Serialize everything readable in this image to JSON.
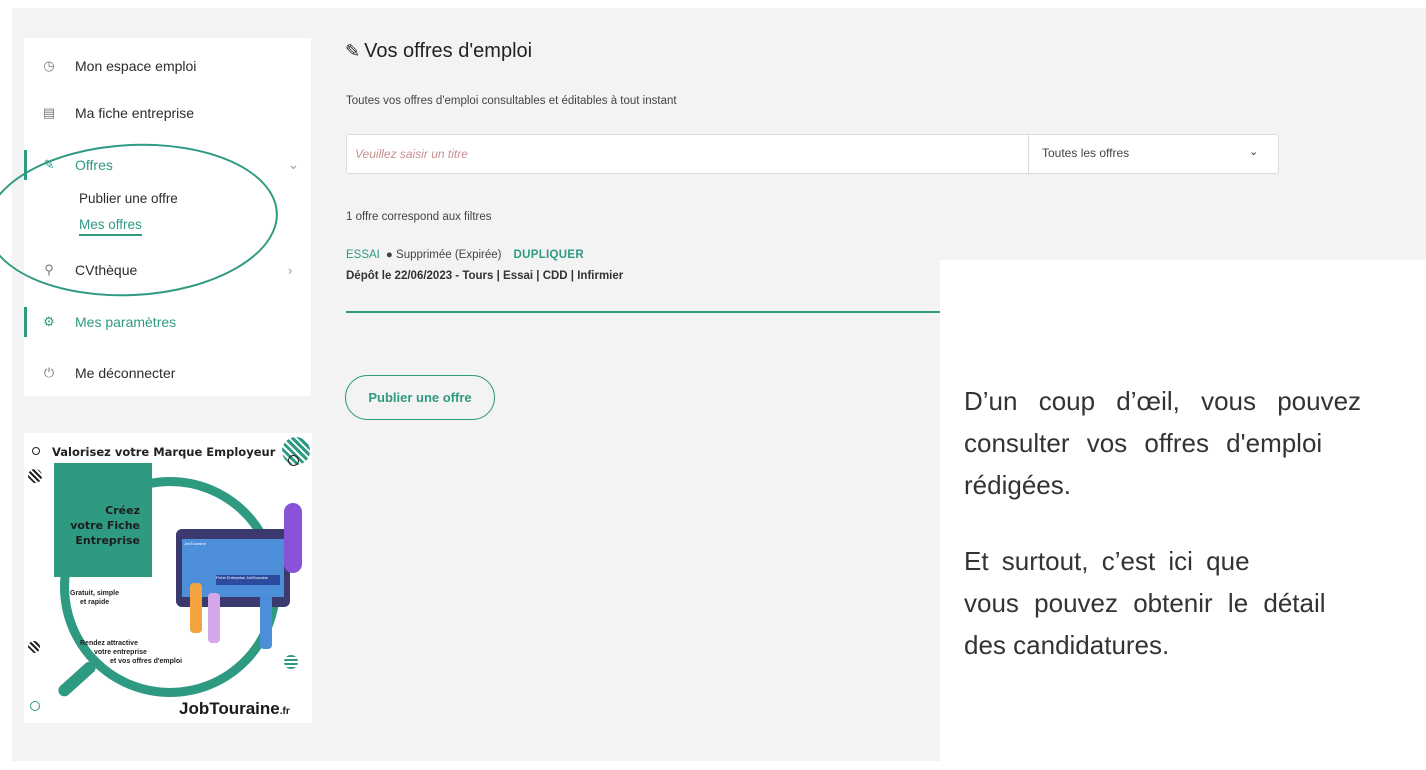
{
  "sidebar": {
    "items": [
      {
        "label": "Mon espace emploi",
        "icon": "dashboard-icon"
      },
      {
        "label": "Ma fiche entreprise",
        "icon": "clipboard-icon"
      },
      {
        "label": "Offres",
        "icon": "edit-icon"
      },
      {
        "label": "CVthèque",
        "icon": "search-icon"
      },
      {
        "label": "Mes paramètres",
        "icon": "settings-icon"
      },
      {
        "label": "Me déconnecter",
        "icon": "power-icon"
      }
    ],
    "offres_sub": [
      "Publier une offre",
      "Mes offres"
    ]
  },
  "banner": {
    "title": "Valorisez votre Marque Employeur",
    "cta_lines": [
      "Créez",
      "votre Fiche",
      "Entreprise"
    ],
    "point1": [
      "Gratuit, simple",
      "et rapide"
    ],
    "point2": [
      "Rendez attractive",
      "votre entreprise",
      "et vos offres d'emploi"
    ],
    "screen_tag": "Fiche Entreprise JobTouraine",
    "screen_header": "JobTouraine",
    "logo": "JobTouraine",
    "logo_suffix": ".fr"
  },
  "main": {
    "title": "Vos offres d'emploi",
    "subtitle": "Toutes vos offres d'emploi consultables et éditables à tout instant",
    "search_placeholder": "Veuillez saisir un titre",
    "filter_selected": "Toutes les offres",
    "count_text": "1 offre correspond aux filtres",
    "offer": {
      "title": "ESSAI",
      "status": "Supprimée (Expirée)",
      "duplicate": "DUPLIQUER",
      "meta": "Dépôt le 22/06/2023 - Tours | Essai | CDD | Infirmier"
    },
    "publish_button": "Publier une offre"
  },
  "overlay": {
    "line1": "D’un coup d’œil, vous pouvez",
    "line2": "consulter vos offres d'emploi",
    "line3": "rédigées.",
    "line4": "Et surtout, c’est ici que",
    "line5": "vous pouvez obtenir le détail",
    "line6": "des candidatures."
  },
  "colors": {
    "accent": "#2f9a82",
    "background": "#f3f3f3"
  }
}
